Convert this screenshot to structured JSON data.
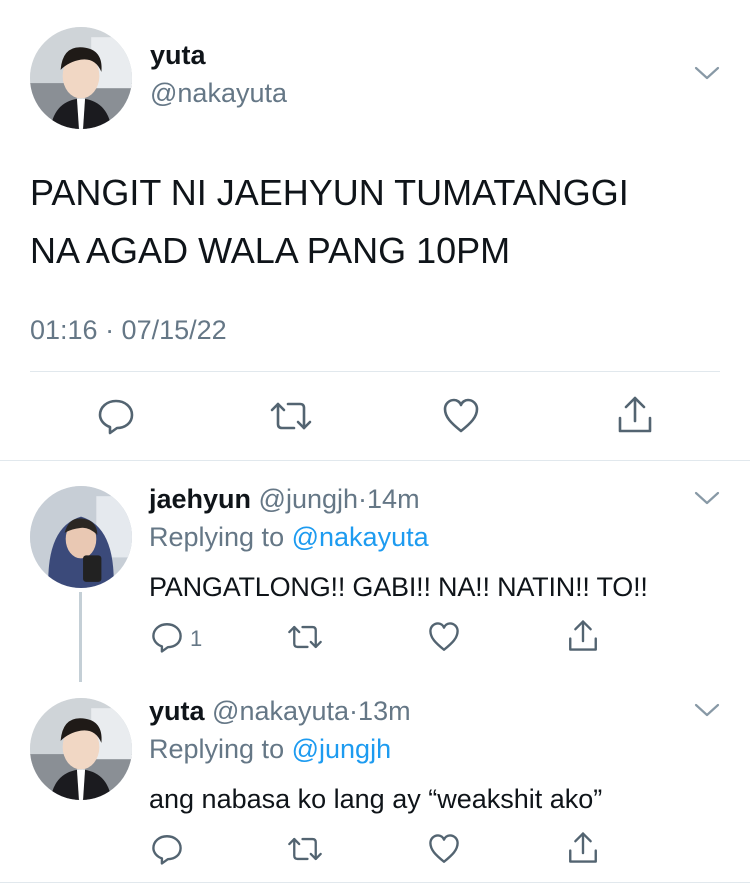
{
  "main_tweet": {
    "display_name": "yuta",
    "handle": "@nakayuta",
    "text_line1": "PANGIT NI JAEHYUN TUMATANGGI",
    "text_line2": "NA AGAD WALA PANG 10PM",
    "timestamp": "01:16 · 07/15/22",
    "avatar_icon": "user-avatar-photo",
    "menu_icon": "chevron-down-icon"
  },
  "replies": [
    {
      "display_name": "jaehyun",
      "handle": "@jungjh",
      "separator": "·",
      "time": "14m",
      "replying_prefix": "Replying to",
      "replying_to": "@nakayuta",
      "text": "PANGATLONG!! GABI!! NA!! NATIN!! TO!!",
      "reply_count": "1"
    },
    {
      "display_name": "yuta",
      "handle": "@nakayuta",
      "separator": "·",
      "time": "13m",
      "replying_prefix": "Replying to",
      "replying_to": "@jungjh",
      "text": "ang nabasa ko lang ay “weakshit ako”",
      "reply_count": ""
    }
  ],
  "colors": {
    "text": "#0f1419",
    "muted": "#657786",
    "link": "#1d9bf0",
    "divider": "#e1e8ed"
  }
}
